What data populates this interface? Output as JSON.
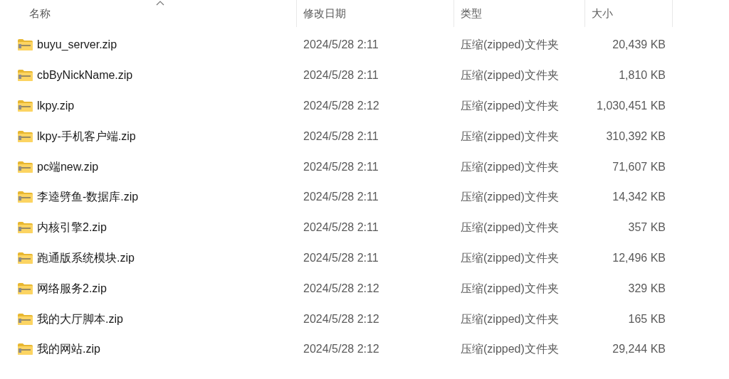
{
  "columns": [
    {
      "label": "名称",
      "sorted": true
    },
    {
      "label": "修改日期",
      "sorted": false
    },
    {
      "label": "类型",
      "sorted": false
    },
    {
      "label": "大小",
      "sorted": false
    }
  ],
  "rows": [
    {
      "name": "buyu_server.zip",
      "modified": "2024/5/28 2:11",
      "type": "压缩(zipped)文件夹",
      "size": "20,439 KB"
    },
    {
      "name": "cbByNickName.zip",
      "modified": "2024/5/28 2:11",
      "type": "压缩(zipped)文件夹",
      "size": "1,810 KB"
    },
    {
      "name": "lkpy.zip",
      "modified": "2024/5/28 2:12",
      "type": "压缩(zipped)文件夹",
      "size": "1,030,451 KB"
    },
    {
      "name": "lkpy-手机客户端.zip",
      "modified": "2024/5/28 2:11",
      "type": "压缩(zipped)文件夹",
      "size": "310,392 KB"
    },
    {
      "name": "pc端new.zip",
      "modified": "2024/5/28 2:11",
      "type": "压缩(zipped)文件夹",
      "size": "71,607 KB"
    },
    {
      "name": "李逵劈鱼-数据库.zip",
      "modified": "2024/5/28 2:11",
      "type": "压缩(zipped)文件夹",
      "size": "14,342 KB"
    },
    {
      "name": "内核引擎2.zip",
      "modified": "2024/5/28 2:11",
      "type": "压缩(zipped)文件夹",
      "size": "357 KB"
    },
    {
      "name": "跑通版系统模块.zip",
      "modified": "2024/5/28 2:11",
      "type": "压缩(zipped)文件夹",
      "size": "12,496 KB"
    },
    {
      "name": "网络服务2.zip",
      "modified": "2024/5/28 2:12",
      "type": "压缩(zipped)文件夹",
      "size": "329 KB"
    },
    {
      "name": "我的大厅脚本.zip",
      "modified": "2024/5/28 2:12",
      "type": "压缩(zipped)文件夹",
      "size": "165 KB"
    },
    {
      "name": "我的网站.zip",
      "modified": "2024/5/28 2:12",
      "type": "压缩(zipped)文件夹",
      "size": "29,244 KB"
    }
  ]
}
